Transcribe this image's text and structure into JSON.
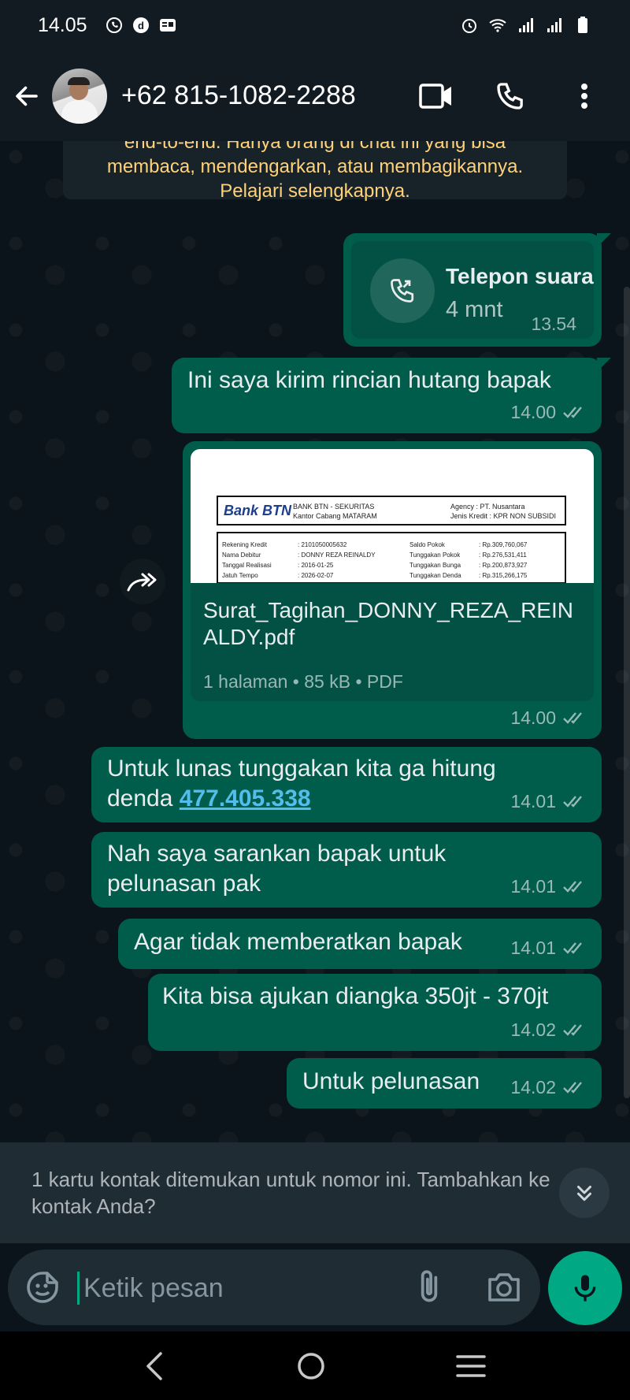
{
  "status_bar": {
    "time": "14.05"
  },
  "header": {
    "contact": "+62 815-1082-2288"
  },
  "encryption_notice": {
    "line1": "end-to-end. Hanya orang di chat ini yang bisa",
    "line2": "membaca, mendengarkan, atau membagikannya.",
    "line3": "Pelajari selengkapnya."
  },
  "messages": {
    "call": {
      "title": "Telepon suara",
      "duration": "4 mnt",
      "time": "13.54"
    },
    "m1": {
      "text": "Ini saya kirim rincian hutang bapak",
      "time": "14.00"
    },
    "doc": {
      "filename": "Surat_Tagihan_DONNY_REZA_REINALDY.pdf",
      "info": "1 halaman • 85 kB • PDF",
      "time": "14.00",
      "preview": {
        "bank": "Bank BTN",
        "bank_line1": "BANK BTN - SEKURITAS",
        "bank_line2": "Kantor Cabang MATARAM",
        "agency": "Agency      : PT. Nusantara",
        "jenis": "Jenis Kredit  : KPR NON SUBSIDI",
        "rows": [
          [
            "Rekening Kredit",
            ": 2101050005632",
            "Saldo Pokok",
            ": Rp.309,760,067"
          ],
          [
            "Nama Debitur",
            ": DONNY REZA REINALDY",
            "Tunggakan Pokok",
            ": Rp.276,531,411"
          ],
          [
            "Tanggal Realisasi",
            ": 2016-01-25",
            "Tunggakan Bunga",
            ": Rp.200,873,927"
          ],
          [
            "Jatuh Tempo",
            ": 2026-02-07",
            "Tunggakan Denda",
            ": Rp.315,266,175"
          ]
        ]
      }
    },
    "m2": {
      "line1": "Untuk lunas tunggakan kita ga hitung",
      "line2_prefix": "denda ",
      "link": "477.405.338",
      "time": "14.01"
    },
    "m3": {
      "line1": "Nah saya sarankan bapak untuk",
      "line2": "pelunasan pak",
      "time": "14.01"
    },
    "m4": {
      "text": "Agar tidak memberatkan bapak",
      "time": "14.01"
    },
    "m5": {
      "text": "Kita bisa ajukan diangka 350jt - 370jt",
      "time": "14.02"
    },
    "m6": {
      "text": "Untuk pelunasan",
      "time": "14.02"
    }
  },
  "contact_prompt": {
    "line1": "1 kartu kontak ditemukan untuk nomor ini. Tambahkan ke",
    "line2": "kontak Anda?"
  },
  "composer": {
    "placeholder": "Ketik pesan"
  },
  "colors": {
    "bubble_out": "#005c4b",
    "accent": "#00a884",
    "link": "#53bdeb",
    "notice": "#ffd279"
  }
}
